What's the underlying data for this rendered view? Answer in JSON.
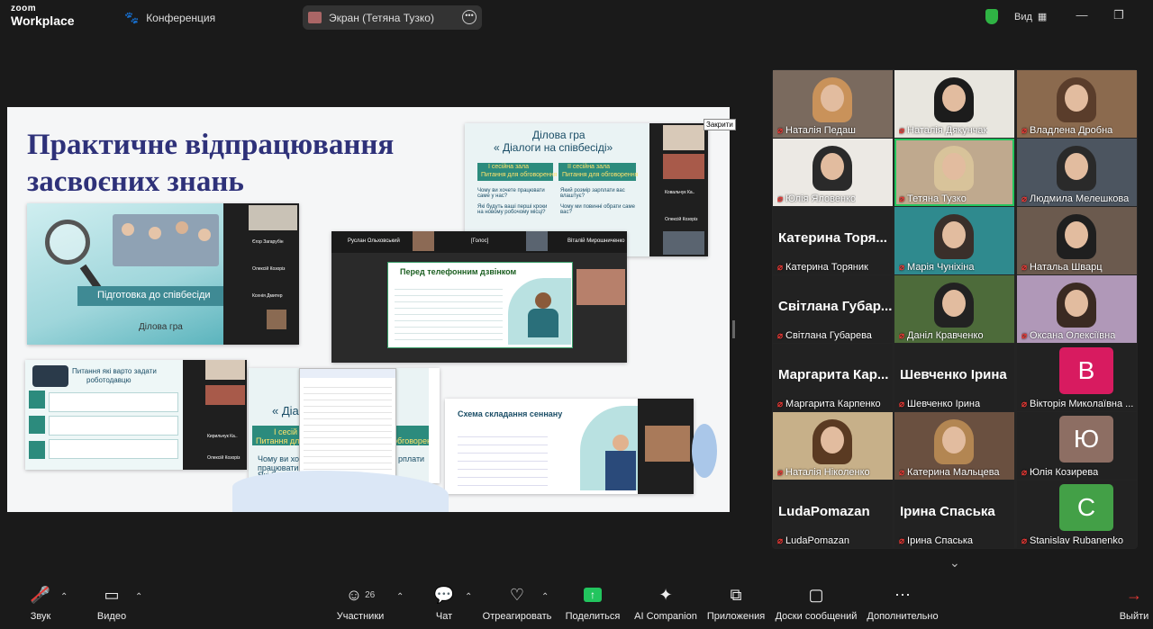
{
  "app": {
    "brand_line1": "zoom",
    "brand_line2": "Workplace",
    "meeting_label": "Конференция",
    "share_label": "Экран (Тетяна Тузко)",
    "view_label": "Вид"
  },
  "colors": {
    "accent_green": "#22c55e",
    "mute_red": "#e53935",
    "slide_title": "#2e3179",
    "share_green": "#2fb344"
  },
  "screen": {
    "closed_label": "Закрити",
    "slide_title_line1": "Практичне відпрацювання",
    "slide_title_line2": "засвоєних знань",
    "card1": {
      "title": "Підготовка до співбесіди",
      "subtitle": "Ділова гра",
      "side_names": [
        "Єгор Загарубін",
        "Олексій Козоріз",
        "Ксенія Дмитер"
      ]
    },
    "card2": {
      "title_line1": "Ділова гра",
      "title_line2": "« Діалоги на співбесіді»",
      "col1_head_line1": "І сесійна зала",
      "col1_head_line2": "Питання для обговорення",
      "col2_head_line1": "ІІ сесійна зала",
      "col2_head_line2": "Питання для обговорення",
      "q1": "Чому ви хочете працювати саме у нас?",
      "q2": "Які будуть ваші перші кроки на новому робочому місці?",
      "q3": "Який розмір зарплати вас влаштує?",
      "q4": "Чому ми повинні обрати саме вас?",
      "side_names": [
        "Ковальчук Ка..",
        "Олексій Козоріз"
      ]
    },
    "card3": {
      "name1": "Руслан Ольховський",
      "name2": "[Голос]",
      "name3": "Віталій Мирошниченко",
      "title": "Перед телефонним дзвінком"
    },
    "card4": {
      "title_line1": "Питання які варто задати",
      "title_line2": "роботодавцю",
      "side_names": [
        "Кирильчук Ка..",
        "Олексій Козоріз"
      ]
    },
    "card5": {
      "title_line1": "« Діа",
      "sess_line1": "І сесій",
      "sess_line2": "Питання для с",
      "sess_right": "обговорення",
      "q1": "Чому ви хоче працювати с",
      "q2": "Які будуть в",
      "q3": "рплати"
    },
    "card6": {
      "title": "Схема складання сеннану"
    }
  },
  "gallery": {
    "participants": [
      {
        "name": "Наталія Педаш",
        "type": "photo",
        "bg": "#7a6a5e",
        "hair": "#c9925a"
      },
      {
        "name": "Наталія Дякунчак",
        "type": "photo",
        "bg": "#e8e6df",
        "hair": "#1c1c1c"
      },
      {
        "name": "Владлена Дробна",
        "type": "photo",
        "bg": "#8b6a4e",
        "hair": "#5a3d2b"
      },
      {
        "name": "Юлія Яловенко",
        "type": "photo",
        "bg": "#ece9e4",
        "hair": "#2a2a2a"
      },
      {
        "name": "Тетяна Тузко",
        "type": "photo",
        "bg": "#bfa98e",
        "hair": "#d8c39a",
        "speaking": true
      },
      {
        "name": "Людмила Мелешкова",
        "type": "photo",
        "bg": "#4c5560",
        "hair": "#2a2a2a"
      },
      {
        "name": "Катерина Торяник",
        "type": "name",
        "big": "Катерина Торя..."
      },
      {
        "name": "Марія Чуніхіна",
        "type": "photo",
        "bg": "#2f8a8e",
        "hair": "#3a2f2a"
      },
      {
        "name": "Натальа Шварц",
        "type": "photo",
        "bg": "#6b5a4e",
        "hair": "#1f1f1f"
      },
      {
        "name": "Світлана Губарева",
        "type": "name",
        "big": "Світлана Губар..."
      },
      {
        "name": "Даніл Кравченко",
        "type": "photo",
        "bg": "#4d6b3a",
        "hair": "#222"
      },
      {
        "name": "Оксана Олексіївна",
        "type": "photo",
        "bg": "#b098b8",
        "hair": "#3a2a22"
      },
      {
        "name": "Маргарита Карпенко",
        "type": "name",
        "big": "Маргарита Кар..."
      },
      {
        "name": "Шевченко Ірина",
        "type": "name",
        "big": "Шевченко Ірина"
      },
      {
        "name": "Вікторія Миколаївна ...",
        "type": "avatar",
        "letter": "В",
        "color": "#d81b60"
      },
      {
        "name": "Наталія Ніколенко",
        "type": "photo",
        "bg": "#c7b089",
        "hair": "#5a3a22"
      },
      {
        "name": "Катерина Мальцева",
        "type": "photo",
        "bg": "#6a5040",
        "hair": "#b38652"
      },
      {
        "name": "Юлія Козирева",
        "type": "avatar",
        "letter": "Ю",
        "color": "#8d6e63"
      },
      {
        "name": "LudaPomazan",
        "type": "name",
        "big": "LudaPomazan"
      },
      {
        "name": "Ірина Спаська",
        "type": "name",
        "big": "Ірина Спаська"
      },
      {
        "name": "Stanislav Rubanenko",
        "type": "avatar",
        "letter": "С",
        "color": "#43a047"
      }
    ]
  },
  "toolbar": {
    "audio": "Звук",
    "video": "Видео",
    "participants": "Участники",
    "participants_count": "26",
    "chat": "Чат",
    "react": "Отреагировать",
    "share": "Поделиться",
    "ai": "AI Companion",
    "apps": "Приложения",
    "whiteboards": "Доски сообщений",
    "more": "Дополнительно",
    "leave": "Выйти"
  }
}
